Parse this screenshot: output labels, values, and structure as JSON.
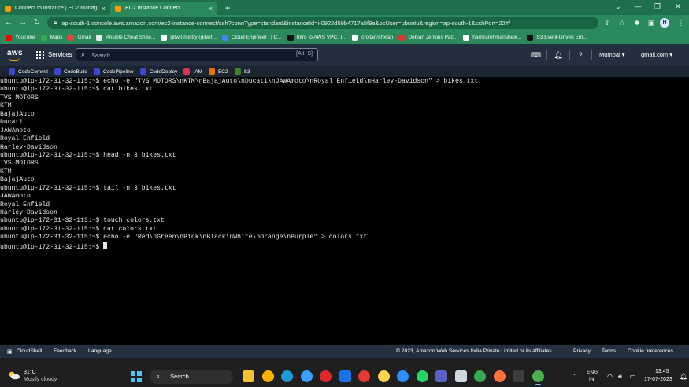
{
  "browser": {
    "tabs": [
      {
        "label": "Connect to instance | EC2 Manag",
        "close": "×"
      },
      {
        "label": "EC2 Instance Connect",
        "close": "×"
      }
    ],
    "new_tab": "+",
    "url": "ap-south-1.console.aws.amazon.com/ec2-instance-connect/ssh?connType=standard&instanceId=i-0922d59b4717a5f9a&osUser=ubuntu&region=ap-south-1&sshPort=22#/",
    "profile_initial": "H",
    "bookmarks": [
      {
        "label": "YouTube",
        "color": "#ff0000"
      },
      {
        "label": "Maps",
        "color": "#34a853"
      },
      {
        "label": "Gmail",
        "color": "#ea4335"
      },
      {
        "label": "Ansible Cheat Shee...",
        "color": "#e8eaed"
      },
      {
        "label": "gitwit-mistry (gitwit...",
        "color": "#ffffff"
      },
      {
        "label": "Cloud Engineer I | C...",
        "color": "#4285f4"
      },
      {
        "label": "Intro to AWS VPC. T...",
        "color": "#111111"
      },
      {
        "label": "chxtan/chxtan",
        "color": "#ffffff"
      },
      {
        "label": "Debian Jenkins Pac...",
        "color": "#d33833"
      },
      {
        "label": "hamzarehmansheik...",
        "color": "#ffffff"
      },
      {
        "label": "S3 Event-Driven Em...",
        "color": "#111111"
      }
    ]
  },
  "aws_nav": {
    "logo": "aws",
    "services_label": "Services",
    "search_placeholder": "Search",
    "search_shortcut": "[Alt+S]",
    "region": "Mumbai ▾",
    "account": "gmail.com ▾",
    "favorites": [
      {
        "label": "CodeCommit",
        "color": "#3b48cc"
      },
      {
        "label": "CodeBuild",
        "color": "#3b48cc"
      },
      {
        "label": "CodePipeline",
        "color": "#3b48cc"
      },
      {
        "label": "CodeDeploy",
        "color": "#3b48cc"
      },
      {
        "label": "IAM",
        "color": "#dd344c"
      },
      {
        "label": "EC2",
        "color": "#ed7100"
      },
      {
        "label": "S3",
        "color": "#3f8624"
      }
    ]
  },
  "terminal": {
    "lines": [
      "ubuntu@ip-172-31-32-115:~$ echo -e \"TVS MOTORS\\nKTM\\nBajajAuto\\nDucati\\nJAWAmoto\\nRoyal Enfield\\nHarley-Davidson\" > bikes.txt",
      "ubuntu@ip-172-31-32-115:~$ cat bikes.txt",
      "TVS MOTORS",
      "KTM",
      "BajajAuto",
      "Ducati",
      "JAWAmoto",
      "Royal Enfield",
      "Harley-Davidson",
      "ubuntu@ip-172-31-32-115:~$ head -n 3 bikes.txt",
      "TVS MOTORS",
      "KTM",
      "BajajAuto",
      "ubuntu@ip-172-31-32-115:~$ tail -n 3 bikes.txt",
      "JAWAmoto",
      "Royal Enfield",
      "Harley-Davidson",
      "ubuntu@ip-172-31-32-115:~$ touch colors.txt",
      "ubuntu@ip-172-31-32-115:~$ cat colors.txt",
      "ubuntu@ip-172-31-32-115:~$ echo -e \"Red\\nGreen\\nPink\\nBlack\\nWhite\\nOrange\\nPurple\" > colors.txt"
    ],
    "prompt": "ubuntu@ip-172-31-32-115:~$ "
  },
  "footer": {
    "cloudshell": "CloudShell",
    "feedback": "Feedback",
    "language": "Language",
    "copyright": "© 2023, Amazon Web Services India Private Limited or its affiliates.",
    "privacy": "Privacy",
    "terms": "Terms",
    "cookies": "Cookie preferences"
  },
  "taskbar": {
    "temperature": "31°C",
    "weather": "Mostly cloudy",
    "search_label": "Search",
    "lang_top": "ENG",
    "lang_bottom": "IN",
    "time": "13:45",
    "date": "17-07-2023",
    "apps": [
      {
        "name": "file-explorer",
        "color": "#f4c430"
      },
      {
        "name": "chrome-profile",
        "color": "#ffb300"
      },
      {
        "name": "edge",
        "color": "#1e9bd7"
      },
      {
        "name": "copilot",
        "color": "#3aa0ff"
      },
      {
        "name": "opera",
        "color": "#e0262c"
      },
      {
        "name": "mail",
        "color": "#1a73e8"
      },
      {
        "name": "chrome-red",
        "color": "#e53935"
      },
      {
        "name": "chrome",
        "color": "#ffd54f"
      },
      {
        "name": "zoom",
        "color": "#2d8cff"
      },
      {
        "name": "whatsapp",
        "color": "#25d366"
      },
      {
        "name": "teams",
        "color": "#5b5fc7"
      },
      {
        "name": "store",
        "color": "#cfd8dc"
      },
      {
        "name": "chrome-green",
        "color": "#34a853"
      },
      {
        "name": "firefox",
        "color": "#ff7139"
      },
      {
        "name": "terminal",
        "color": "#3c3c3c"
      },
      {
        "name": "chrome-active",
        "color": "#4caf50"
      }
    ]
  }
}
